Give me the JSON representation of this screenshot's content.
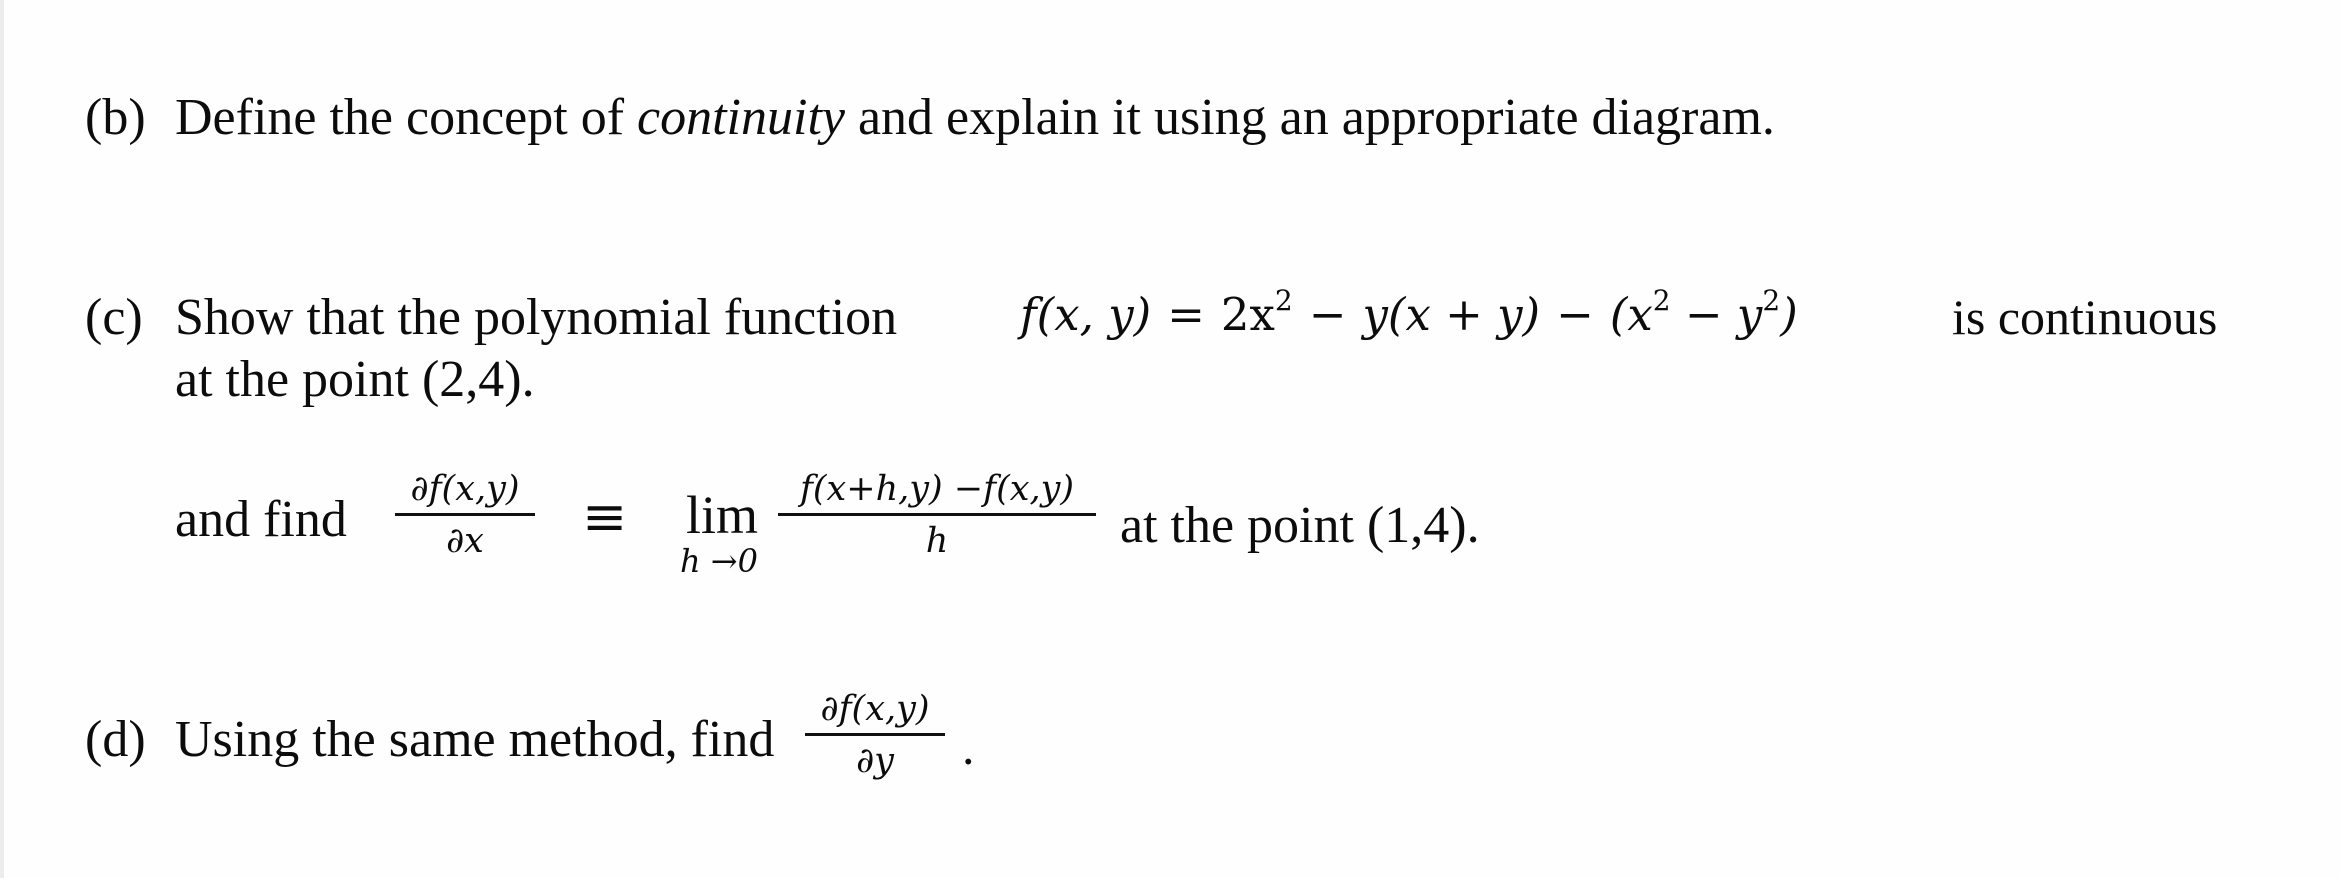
{
  "part_b": {
    "label": "(b)",
    "text_before": "Define the concept of ",
    "emphasis": "continuity",
    "text_after": " and explain it using an appropriate diagram."
  },
  "part_c": {
    "label": "(c)",
    "text_1": "Show that the polynomial function",
    "function_lhs": "f(x, y)",
    "equals": "=",
    "function_rhs": {
      "term1": "2x",
      "term1_exp": "2",
      "minus1": "−",
      "term2": "y(x + y)",
      "minus2": "−",
      "term3_open": "(x",
      "term3_exp1": "2",
      "term3_minus": " − y",
      "term3_exp2": "2",
      "term3_close": ")"
    },
    "text_2": "is continuous",
    "text_3": "at the point (2,4).",
    "find_label": "and find",
    "partial_x": {
      "numerator": "∂f(x,y)",
      "denominator": "∂x"
    },
    "equiv": "≡",
    "limit": {
      "lim": "lim",
      "subscript": "h →0"
    },
    "difference_quotient": {
      "numerator": "f(x+h,y) −f(x,y)",
      "denominator": "h"
    },
    "text_4": "at the point (1,4)."
  },
  "part_d": {
    "label": "(d)",
    "text": "Using the same method, find",
    "partial_y": {
      "numerator": "∂f(x,y)",
      "denominator": "∂y"
    },
    "end": "."
  }
}
